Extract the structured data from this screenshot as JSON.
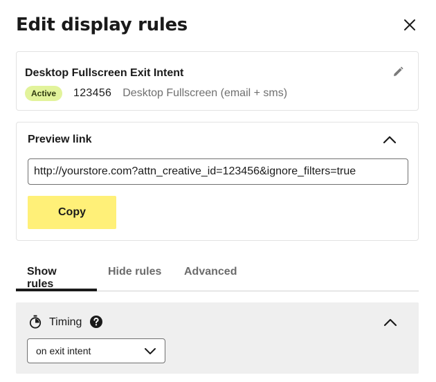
{
  "header": {
    "title": "Edit display rules"
  },
  "creative": {
    "name": "Desktop Fullscreen Exit Intent",
    "status_badge": "Active",
    "id": "123456",
    "type": "Desktop Fullscreen (email + sms)"
  },
  "preview": {
    "label": "Preview link",
    "link_value": "http://yourstore.com?attn_creative_id=123456&ignore_filters=true",
    "copy_label": "Copy"
  },
  "tabs": [
    {
      "label": "Show rules",
      "active": true
    },
    {
      "label": "Hide rules",
      "active": false
    },
    {
      "label": "Advanced",
      "active": false
    }
  ],
  "timing": {
    "label": "Timing",
    "selected": "on exit intent"
  },
  "colors": {
    "badge_bg": "#e2f39b",
    "copy_button_bg": "#fff078",
    "section_bg": "#efefef"
  },
  "icons": [
    "close-icon",
    "pencil-icon",
    "chevron-up-icon",
    "timer-icon",
    "help-icon",
    "chevron-down-icon"
  ]
}
